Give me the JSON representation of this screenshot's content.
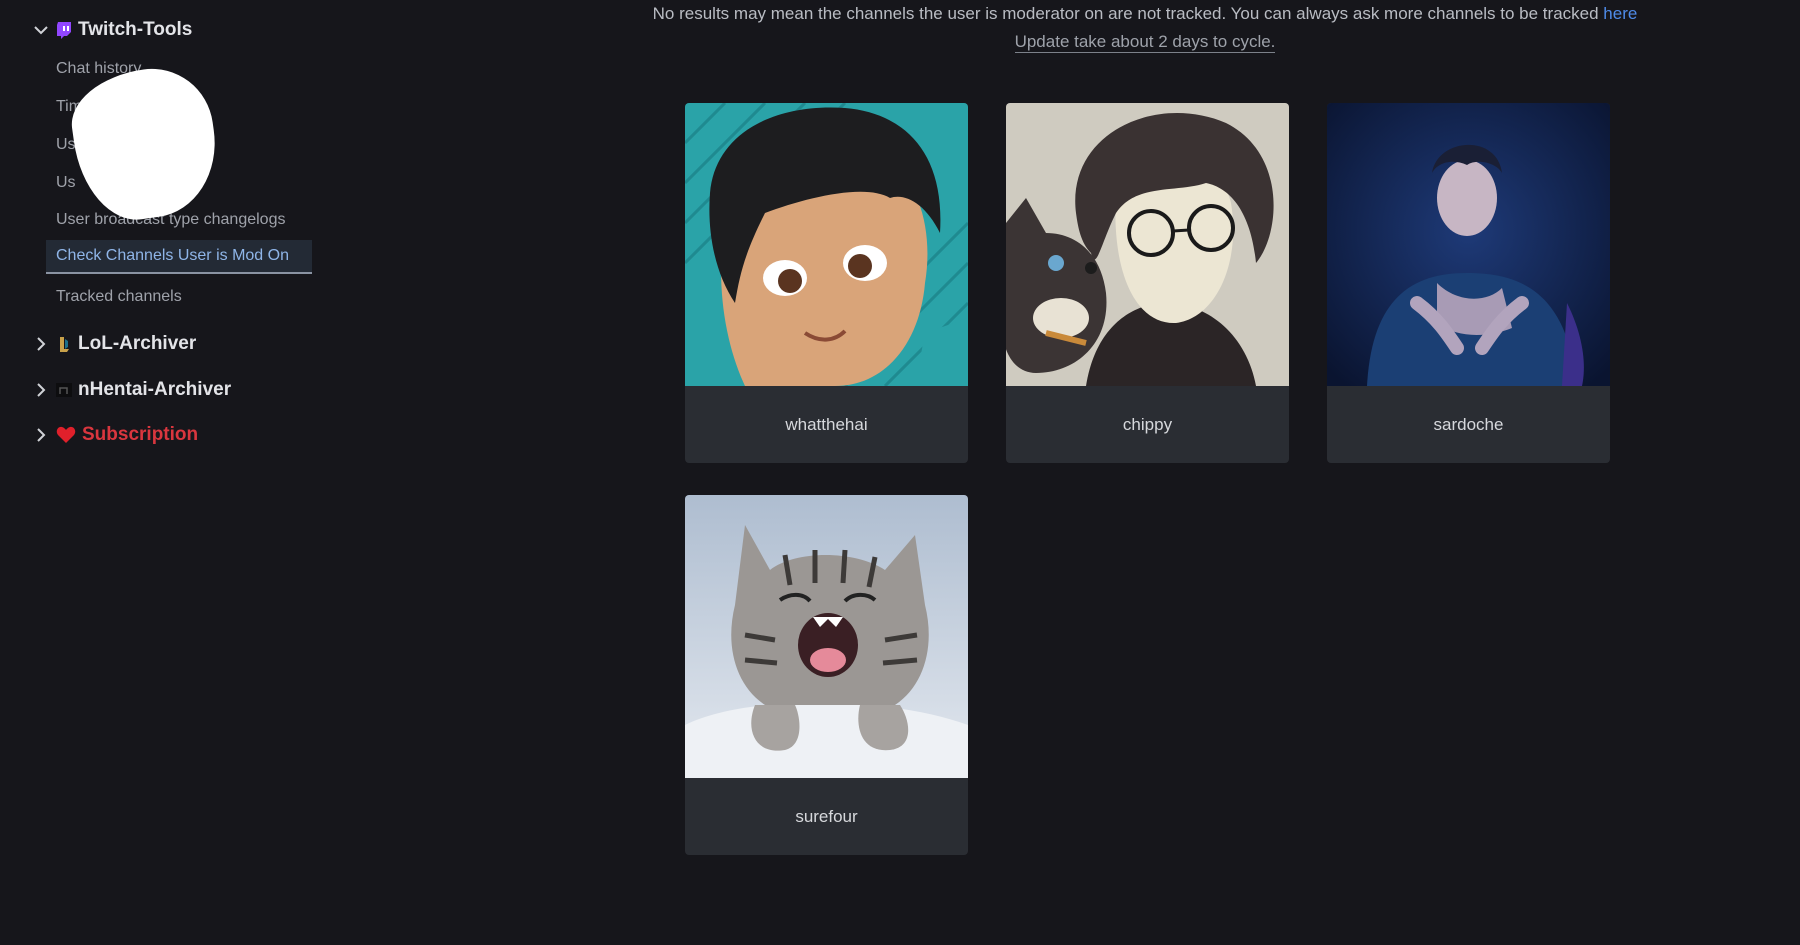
{
  "sidebar": {
    "sections": [
      {
        "label": "Twitch-Tools",
        "expanded": true,
        "icon": "twitch-icon"
      },
      {
        "label": "LoL-Archiver",
        "expanded": false,
        "icon": "lol-icon"
      },
      {
        "label": "nHentai-Archiver",
        "expanded": false,
        "icon": "nhentai-icon"
      },
      {
        "label": "Subscription",
        "expanded": false,
        "icon": "heart-icon"
      }
    ],
    "twitch_items": [
      {
        "label": "Chat history"
      },
      {
        "label": "Tim"
      },
      {
        "label": "Us             logs"
      },
      {
        "label": "Us        changelogs"
      },
      {
        "label": "User broadcast type changelogs"
      },
      {
        "label": "Check Channels User is Mod On",
        "active": true
      },
      {
        "label": "Tracked channels"
      }
    ]
  },
  "notice": {
    "text": "No results may mean the channels the user is moderator on are not tracked. You can always ask more channels to be tracked",
    "link": "here",
    "update": "Update take about 2 days to cycle."
  },
  "channels": [
    {
      "name": "whatthehai"
    },
    {
      "name": "chippy"
    },
    {
      "name": "sardoche"
    },
    {
      "name": "surefour"
    }
  ],
  "colors": {
    "background": "#16161b",
    "card": "#2a2d33",
    "link": "#4f8be8",
    "active_item": "#8fb5e8",
    "subscription": "#d9363e",
    "twitch_purple": "#9146ff"
  }
}
